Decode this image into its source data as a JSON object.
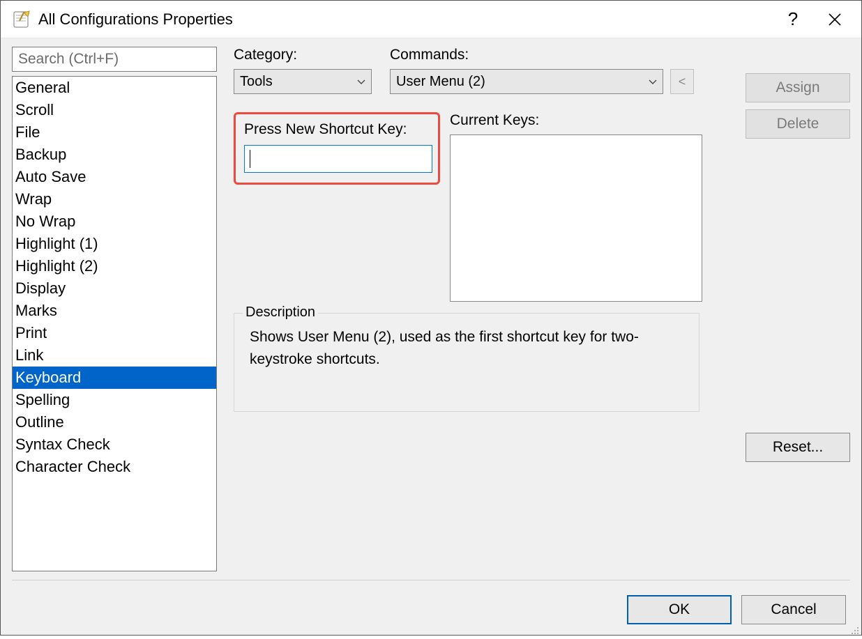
{
  "title": "All Configurations Properties",
  "search": {
    "placeholder": "Search (Ctrl+F)",
    "value": ""
  },
  "sidebar": {
    "items": [
      {
        "label": "General"
      },
      {
        "label": "Scroll"
      },
      {
        "label": "File"
      },
      {
        "label": "Backup"
      },
      {
        "label": "Auto Save"
      },
      {
        "label": "Wrap"
      },
      {
        "label": "No Wrap"
      },
      {
        "label": "Highlight (1)"
      },
      {
        "label": "Highlight (2)"
      },
      {
        "label": "Display"
      },
      {
        "label": "Marks"
      },
      {
        "label": "Print"
      },
      {
        "label": "Link"
      },
      {
        "label": "Keyboard"
      },
      {
        "label": "Spelling"
      },
      {
        "label": "Outline"
      },
      {
        "label": "Syntax Check"
      },
      {
        "label": "Character Check"
      }
    ],
    "selected_index": 13
  },
  "labels": {
    "category": "Category:",
    "commands": "Commands:",
    "press_new": "Press New Shortcut Key:",
    "current_keys": "Current Keys:",
    "description": "Description"
  },
  "category": {
    "selected": "Tools"
  },
  "command": {
    "selected": "User Menu (2)"
  },
  "back_button": "<",
  "shortcut_input": {
    "value": ""
  },
  "current_keys": [],
  "description_text": "Shows User Menu (2), used as the first shortcut key for two-keystroke shortcuts.",
  "buttons": {
    "assign": "Assign",
    "delete": "Delete",
    "reset": "Reset...",
    "ok": "OK",
    "cancel": "Cancel",
    "help": "?"
  }
}
